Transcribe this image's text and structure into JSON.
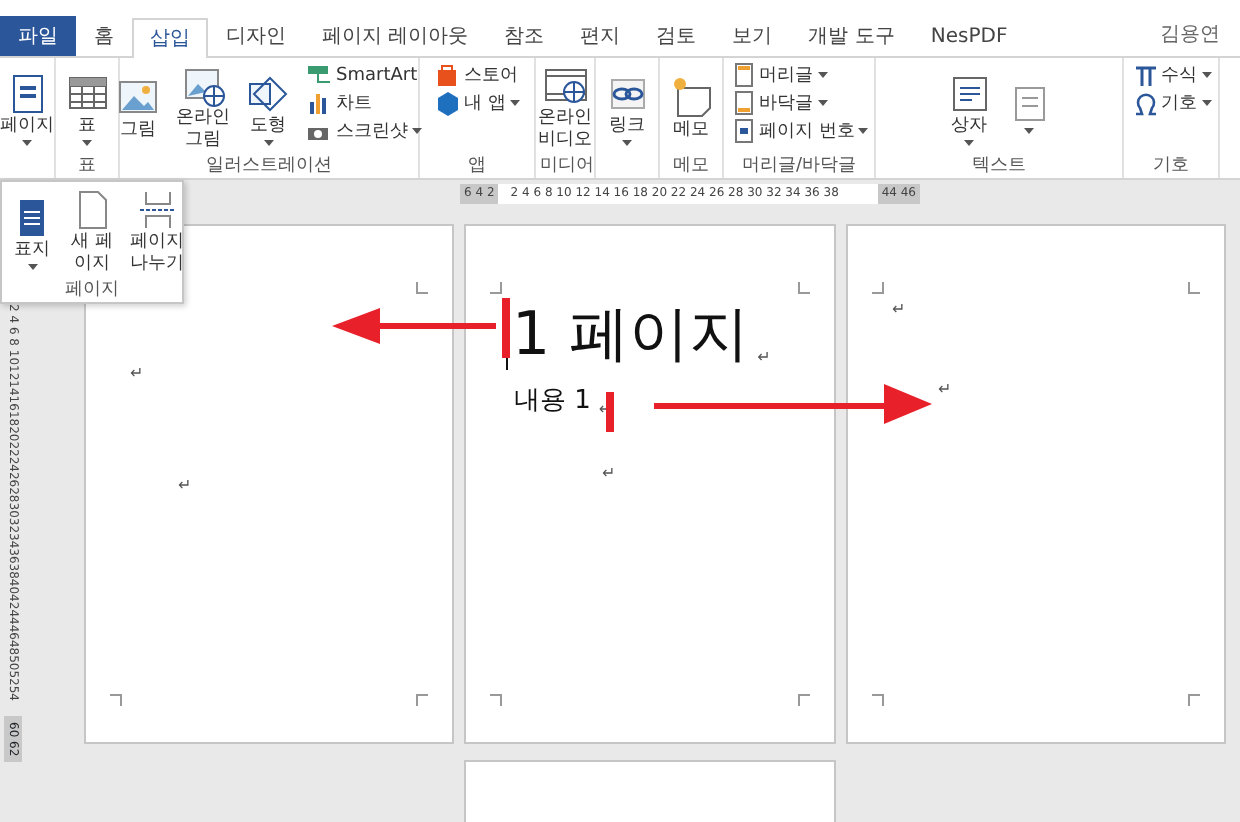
{
  "tabs": [
    {
      "label": "파일",
      "kind": "file",
      "selected": false
    },
    {
      "label": "홈",
      "kind": "tab",
      "selected": false
    },
    {
      "label": "삽입",
      "kind": "tab",
      "selected": true
    },
    {
      "label": "디자인",
      "kind": "tab",
      "selected": false
    },
    {
      "label": "페이지 레이아웃",
      "kind": "tab",
      "selected": false
    },
    {
      "label": "참조",
      "kind": "tab",
      "selected": false
    },
    {
      "label": "편지",
      "kind": "tab",
      "selected": false
    },
    {
      "label": "검토",
      "kind": "tab",
      "selected": false
    },
    {
      "label": "보기",
      "kind": "tab",
      "selected": false
    },
    {
      "label": "개발 도구",
      "kind": "tab",
      "selected": false
    },
    {
      "label": "NesPDF",
      "kind": "tab",
      "selected": false
    }
  ],
  "account": "김용연",
  "ribbon_groups": [
    {
      "items": [
        {
          "label": "페이지",
          "kind": "large",
          "dropdown": true
        }
      ]
    },
    {
      "label": "표",
      "items": [
        {
          "label": "표",
          "kind": "large",
          "dropdown": true
        }
      ]
    },
    {
      "label": "일러스트레이션",
      "items": [
        {
          "label": "그림",
          "kind": "large",
          "dropdown": false
        },
        {
          "label": "온라인\n그림",
          "kind": "large",
          "dropdown": false
        },
        {
          "label": "도형",
          "kind": "large",
          "dropdown": true
        },
        {
          "label": "SmartArt",
          "kind": "small",
          "dropdown": false
        },
        {
          "label": "차트",
          "kind": "small",
          "dropdown": false
        },
        {
          "label": "스크린샷",
          "kind": "small",
          "dropdown": true
        }
      ]
    },
    {
      "label": "앱",
      "items": [
        {
          "label": "스토어",
          "kind": "small",
          "dropdown": false
        },
        {
          "label": "내 앱",
          "kind": "small",
          "dropdown": true
        }
      ]
    },
    {
      "label": "미디어",
      "items": [
        {
          "label": "온라인\n비디오",
          "kind": "large",
          "dropdown": false
        }
      ]
    },
    {
      "items": [
        {
          "label": "링크",
          "kind": "large",
          "dropdown": true
        }
      ]
    },
    {
      "label": "메모",
      "items": [
        {
          "label": "메모",
          "kind": "large",
          "dropdown": false
        }
      ]
    },
    {
      "label": "머리글/바닥글",
      "items": [
        {
          "label": "머리글",
          "kind": "small",
          "dropdown": true
        },
        {
          "label": "바닥글",
          "kind": "small",
          "dropdown": true
        },
        {
          "label": "페이지 번호",
          "kind": "small",
          "dropdown": true
        }
      ]
    },
    {
      "label": "텍스트",
      "items": [
        {
          "label": "상자",
          "kind": "large",
          "dropdown": true
        },
        {
          "kind": "large",
          "dropdown": true
        }
      ]
    },
    {
      "label": "기호",
      "items": [
        {
          "label": "수식",
          "kind": "small",
          "dropdown": true
        },
        {
          "label": "기호",
          "kind": "small",
          "dropdown": true
        }
      ]
    }
  ],
  "page_popup": {
    "label": "페이지",
    "items": [
      {
        "label": "표지",
        "dropdown": true
      },
      {
        "label": "새 페\n이지",
        "dropdown": false
      },
      {
        "label": "페이지\n나누기",
        "dropdown": false
      }
    ]
  },
  "top_ruler": {
    "left": "6 4 2",
    "middle": "2 4 6 8 10 12 14 16 18 20 22 24 26 28 30 32 34 36 38",
    "right": "44 46"
  },
  "left_ruler": {
    "main": "2 4 6 8 1012141618202224262830323436384042444648505254",
    "bottom": "60 62"
  },
  "pages": [
    {
      "paragraphs": [
        {
          "kind": "mark",
          "text": "↵"
        },
        {
          "kind": "mark",
          "text": "↵"
        }
      ]
    },
    {
      "paragraphs": [
        {
          "kind": "heading",
          "text": "1 페이지",
          "mark": "↵"
        },
        {
          "kind": "body",
          "text": "내용 1",
          "mark": "↵"
        },
        {
          "kind": "mark",
          "text": "↵"
        }
      ]
    },
    {
      "paragraphs": [
        {
          "kind": "mark",
          "text": "↵"
        },
        {
          "kind": "mark",
          "text": "↵"
        }
      ]
    }
  ]
}
